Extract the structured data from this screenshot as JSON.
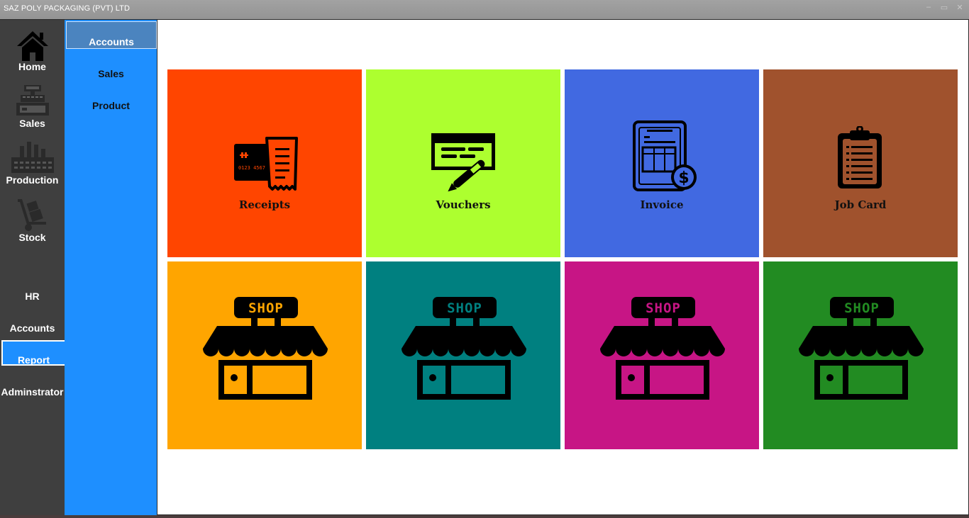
{
  "window": {
    "title": "SAZ POLY PACKAGING (PVT) LTD"
  },
  "titlebar_controls": {
    "minimize": "–",
    "maximize": "▭",
    "close": "✕"
  },
  "leftnav": {
    "items": [
      {
        "label": "Home",
        "icon": "home-icon"
      },
      {
        "label": "Sales",
        "icon": "cash-register-icon"
      },
      {
        "label": "Production",
        "icon": "factory-icon"
      },
      {
        "label": "Stock",
        "icon": "hand-truck-icon"
      }
    ],
    "text_items": [
      {
        "label": "HR"
      },
      {
        "label": "Accounts"
      },
      {
        "label": "Report",
        "active": true
      },
      {
        "label": "Adminstrator"
      }
    ]
  },
  "subnav": {
    "active_tab": "Accounts",
    "items": [
      {
        "label": "Sales"
      },
      {
        "label": "Product"
      }
    ]
  },
  "tiles": [
    {
      "label": "Receipts",
      "color": "#ff4500",
      "icon": "receipt-card-icon"
    },
    {
      "label": "Vouchers",
      "color": "#adff2f",
      "icon": "cheque-pen-icon"
    },
    {
      "label": "Invoice",
      "color": "#4169e1",
      "icon": "invoice-dollar-icon"
    },
    {
      "label": "Job Card",
      "color": "#a0522d",
      "icon": "clipboard-icon"
    },
    {
      "sign": "SHOP",
      "color": "#ffa500",
      "sign_text_color": "#ffa500",
      "icon": "shop-icon"
    },
    {
      "sign": "SHOP",
      "color": "#008080",
      "sign_text_color": "#008080",
      "icon": "shop-icon"
    },
    {
      "sign": "SHOP",
      "color": "#c71585",
      "sign_text_color": "#c71585",
      "icon": "shop-icon"
    },
    {
      "sign": "SHOP",
      "color": "#228b22",
      "sign_text_color": "#228b22",
      "icon": "shop-icon"
    }
  ],
  "colors": {
    "leftnav_bg": "#3f3f3f",
    "subnav_bg": "#1e8fff",
    "active_tab_bg": "#4b84bf"
  }
}
